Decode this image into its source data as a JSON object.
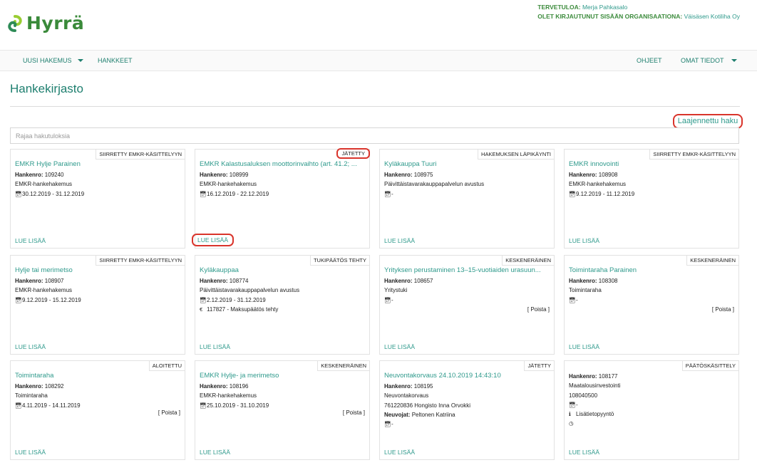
{
  "app": {
    "logo_text": "Hyrrä"
  },
  "user": {
    "welcome_label": "TERVETULOA:",
    "welcome_name": "Merja Pahkasalo",
    "org_label": "OLET KIRJAUTUNUT SISÄÄN ORGANISAATIONA:",
    "org_name": "Väisäsen Kotiliha Oy"
  },
  "nav": {
    "new_application": "UUSI HAKEMUS",
    "projects": "HANKKEET",
    "help": "OHJEET",
    "my_info": "OMAT TIEDOT"
  },
  "page": {
    "title": "Hankekirjasto",
    "advanced_search": "Laajennettu haku",
    "search_placeholder": "Rajaa hakutuloksia",
    "read_more": "LUE LISÄÄ",
    "delete": "[ Poista ]"
  },
  "cards": [
    {
      "status": "SIIRRETTY EMKR-KÄSITTELYYN",
      "title": "EMKR Hylje Parainen",
      "number_label": "Hankenro:",
      "number": "109240",
      "lines": [
        "EMKR-hankehakemus"
      ],
      "dates": "30.12.2019 - 31.12.2019"
    },
    {
      "status": "JÄTETTY",
      "title": "EMKR Kalastusaluksen moottorinvaihto (art. 41.2; ...",
      "number_label": "Hankenro:",
      "number": "108999",
      "lines": [
        "EMKR-hankehakemus"
      ],
      "dates": "16.12.2019 - 22.12.2019"
    },
    {
      "status": "HAKEMUKSEN LÄPIKÄYNTI",
      "title": "Kyläkauppa Tuuri",
      "number_label": "Hankenro:",
      "number": "108975",
      "lines": [
        "Päivittäistavarakauppapalvelun avustus"
      ],
      "dates": "-"
    },
    {
      "status": "SIIRRETTY EMKR-KÄSITTELYYN",
      "title": "EMKR innovointi",
      "number_label": "Hankenro:",
      "number": "108908",
      "lines": [
        "EMKR-hankehakemus"
      ],
      "dates": "9.12.2019 - 11.12.2019"
    },
    {
      "status": "SIIRRETTY EMKR-KÄSITTELYYN",
      "title": "Hylje tai merimetso",
      "number_label": "Hankenro:",
      "number": "108907",
      "lines": [
        "EMKR-hankehakemus"
      ],
      "dates": "9.12.2019 - 15.12.2019"
    },
    {
      "status": "TUKIPÄÄTÖS TEHTY",
      "title": "Kyläkauppaa",
      "number_label": "Hankenro:",
      "number": "108774",
      "lines": [
        "Päivittäistavarakauppapalvelun avustus"
      ],
      "dates": "2.12.2019 - 31.12.2019",
      "payment": "117827 - Maksupäätös tehty"
    },
    {
      "status": "KESKENERÄINEN",
      "title": "Yrityksen perustaminen 13–15-vuotiaiden urasuun...",
      "number_label": "Hankenro:",
      "number": "108657",
      "lines": [
        "Yritystuki"
      ],
      "dates": "-"
    },
    {
      "status": "KESKENERÄINEN",
      "title": "Toimintaraha Parainen",
      "number_label": "Hankenro:",
      "number": "108308",
      "lines": [
        "Toimintaraha"
      ],
      "dates": "-"
    },
    {
      "status": "ALOITETTU",
      "title": "Toimintaraha",
      "number_label": "Hankenro:",
      "number": "108292",
      "lines": [
        "Toimintaraha"
      ],
      "dates": "4.11.2019 - 14.11.2019"
    },
    {
      "status": "KESKENERÄINEN",
      "title": "EMKR Hylje- ja merimetso",
      "number_label": "Hankenro:",
      "number": "108196",
      "lines": [
        "EMKR-hankehakemus"
      ],
      "dates": "25.10.2019 - 31.10.2019"
    },
    {
      "status": "JÄTETTY",
      "title": "Neuvontakorvaus 24.10.2019 14:43:10",
      "number_label": "Hankenro:",
      "number": "108195",
      "lines": [
        "Neuvontakorvaus",
        "761220836 Hongisto Inna Orvokki"
      ],
      "advisors_label": "Neuvojat:",
      "advisors": "Peltonen Katriina",
      "dates": "-"
    },
    {
      "status": "PÄÄTÖSKÄSITTELY",
      "title": "",
      "number_label": "Hankenro:",
      "number": "108177",
      "lines": [
        "Maatalousinvestointi",
        "108040500"
      ],
      "dates": "-",
      "info": "Lisätietopyyntö"
    }
  ],
  "icons": {
    "calendar": "calendar-icon",
    "euro": "euro-icon",
    "info": "info-icon",
    "clock": "clock-icon"
  },
  "colors": {
    "brand_green": "#3a8a3a",
    "link_teal": "#2f9a8c",
    "annotation_red": "#d9342b"
  }
}
